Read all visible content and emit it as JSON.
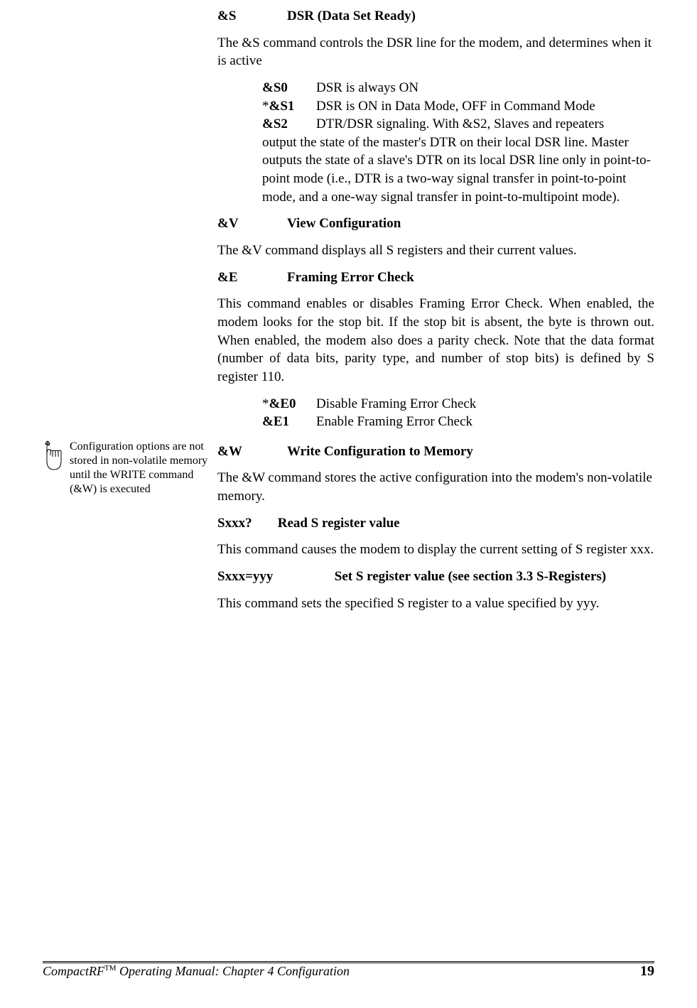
{
  "sections": {
    "ampS": {
      "cmd": "&S",
      "title": "DSR (Data Set Ready)",
      "intro": "The &S command controls the DSR line for the modem, and determines when it is active",
      "options": {
        "s0": {
          "label": "&S0",
          "desc": "DSR is always ON"
        },
        "s1": {
          "prefix": "*",
          "label": "&S1",
          "desc": "DSR is ON in Data Mode, OFF in Command Mode"
        },
        "s2": {
          "label": "&S2",
          "desc": "DTR/DSR signaling.  With &S2, Slaves and repeaters"
        },
        "continuation": "output the state of the master's DTR on their local DSR line.  Master outputs the state of a slave's DTR on its local DSR line only in point-to-point mode (i.e., DTR is a two-way signal transfer in point-to-point mode, and a one-way signal transfer in point-to-multipoint mode)."
      }
    },
    "ampV": {
      "cmd": "&V",
      "title": "View Configuration",
      "intro": "The &V command displays all S registers and their current values."
    },
    "ampE": {
      "cmd": "&E",
      "title": "Framing Error Check",
      "intro": "This command enables or disables Framing Error Check.  When enabled, the modem looks for the stop bit.  If the stop bit is absent, the byte is thrown out.  When enabled, the modem also does a parity check.  Note that the data format (number of data bits, parity type, and number of stop bits) is defined by S register 110.",
      "options": {
        "e0": {
          "prefix": "*",
          "label": "&E0",
          "desc": "Disable Framing Error Check"
        },
        "e1": {
          "label": "&E1",
          "desc": "Enable Framing Error Check"
        }
      }
    },
    "ampW": {
      "cmd": "&W",
      "title": "Write Configuration to Memory",
      "intro": "The &W command stores the active configuration into the modem's non-volatile memory.",
      "margin_note": "Configuration options are not stored in non-volatile memory until the WRITE command (&W) is executed"
    },
    "sxxxQ": {
      "cmd": "Sxxx?",
      "title": "Read S register value",
      "intro": "This command causes the modem to display the current setting of S register xxx."
    },
    "sxxxY": {
      "cmd": "Sxxx=yyy",
      "title": "Set S register value (see section 3.3 S-Registers)",
      "intro": "This command sets the specified S register to a value specified by yyy."
    }
  },
  "footer": {
    "product": "CompactRF",
    "tm": "TM",
    "rest": " Operating Manual: Chapter 4 Configuration",
    "page": "19"
  }
}
